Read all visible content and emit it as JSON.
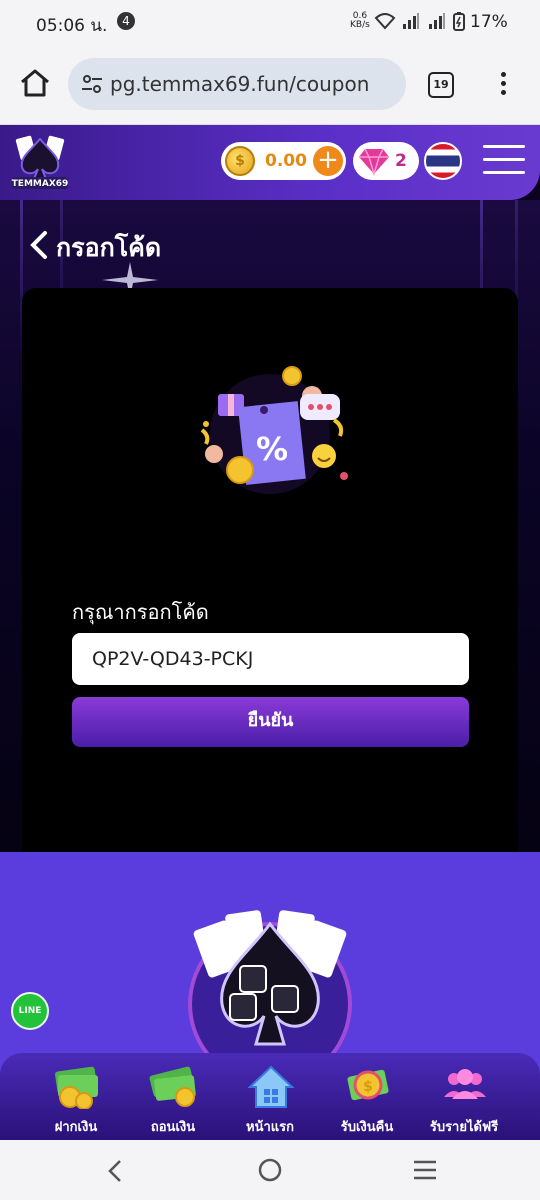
{
  "status_bar": {
    "time": "05:06 น.",
    "notification_count": "4",
    "net_speed_value": "0.6",
    "net_speed_unit": "KB/s",
    "battery": "17%"
  },
  "browser": {
    "url": "pg.temmax69.fun/coupon",
    "tab_count": "19"
  },
  "header": {
    "logo_text": "TEMMAX69",
    "coin_symbol": "$",
    "coin_balance": "0.00",
    "gem_count": "2",
    "flag": "thailand"
  },
  "page": {
    "title": "กรอกโค้ด",
    "code_label": "กรุณากรอกโค้ด",
    "code_value": "QP2V-QD43-PCKJ",
    "confirm_label": "ยืนยัน",
    "line_label": "LINE"
  },
  "bottom_nav": {
    "items": [
      {
        "label": "ฝากเงิน",
        "icon": "cash-deposit-icon"
      },
      {
        "label": "ถอนเงิน",
        "icon": "cash-withdraw-icon"
      },
      {
        "label": "หน้าแรก",
        "icon": "home-icon"
      },
      {
        "label": "รับเงินคืน",
        "icon": "cashback-icon"
      },
      {
        "label": "รับรายได้ฟรี",
        "icon": "people-icon"
      }
    ]
  },
  "colors": {
    "accent": "#5a2fc8",
    "button": "#6a2cc8",
    "coin": "#e58a10",
    "gem": "#c02a8a"
  }
}
